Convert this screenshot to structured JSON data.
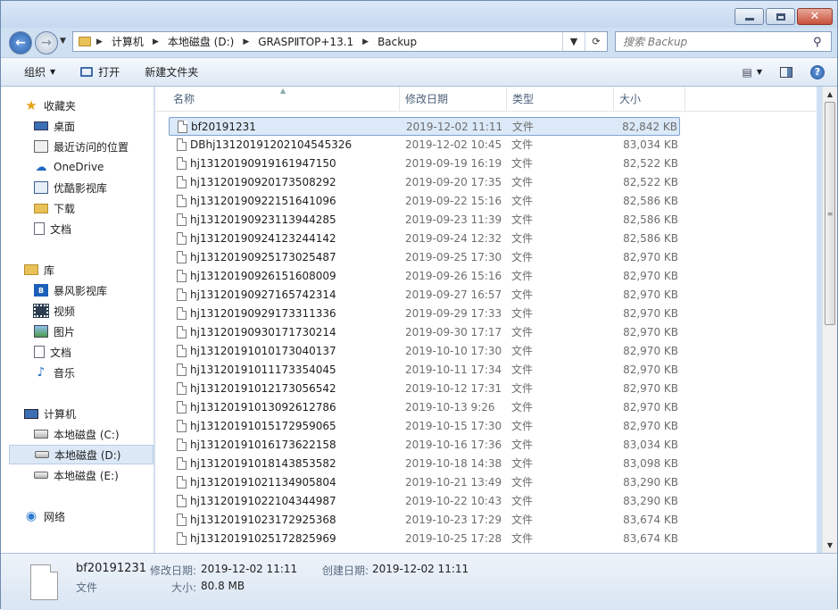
{
  "address": {
    "path": [
      "计算机",
      "本地磁盘 (D:)",
      "GRASPⅡTOP+13.1",
      "Backup"
    ]
  },
  "search": {
    "placeholder": "搜索 Backup"
  },
  "toolbar": {
    "organize": "组织",
    "open": "打开",
    "new_folder": "新建文件夹"
  },
  "nav": {
    "favorites": "收藏夹",
    "fav_items": [
      "桌面",
      "最近访问的位置",
      "OneDrive",
      "优酷影视库",
      "下载",
      "文档"
    ],
    "libraries": "库",
    "lib_items": [
      "暴风影视库",
      "视频",
      "图片",
      "文档",
      "音乐"
    ],
    "computer": "计算机",
    "drives": [
      "本地磁盘 (C:)",
      "本地磁盘 (D:)",
      "本地磁盘 (E:)"
    ],
    "network": "网络"
  },
  "columns": {
    "name": "名称",
    "date": "修改日期",
    "type": "类型",
    "size": "大小"
  },
  "files": [
    {
      "name": "bf20191231",
      "date": "2019-12-02 11:11",
      "type": "文件",
      "size": "82,842 KB"
    },
    {
      "name": "DBhj1312019120210454532​6",
      "date": "2019-12-02 10:45",
      "type": "文件",
      "size": "83,034 KB"
    },
    {
      "name": "hj13120190919161947150",
      "date": "2019-09-19 16:19",
      "type": "文件",
      "size": "82,522 KB"
    },
    {
      "name": "hj13120190920173508292",
      "date": "2019-09-20 17:35",
      "type": "文件",
      "size": "82,522 KB"
    },
    {
      "name": "hj13120190922151641096",
      "date": "2019-09-22 15:16",
      "type": "文件",
      "size": "82,586 KB"
    },
    {
      "name": "hj13120190923113944285",
      "date": "2019-09-23 11:39",
      "type": "文件",
      "size": "82,586 KB"
    },
    {
      "name": "hj13120190924123244142",
      "date": "2019-09-24 12:32",
      "type": "文件",
      "size": "82,586 KB"
    },
    {
      "name": "hj13120190925173025487",
      "date": "2019-09-25 17:30",
      "type": "文件",
      "size": "82,970 KB"
    },
    {
      "name": "hj13120190926151608009",
      "date": "2019-09-26 15:16",
      "type": "文件",
      "size": "82,970 KB"
    },
    {
      "name": "hj13120190927165742314",
      "date": "2019-09-27 16:57",
      "type": "文件",
      "size": "82,970 KB"
    },
    {
      "name": "hj13120190929173311336",
      "date": "2019-09-29 17:33",
      "type": "文件",
      "size": "82,970 KB"
    },
    {
      "name": "hj13120190930171730214",
      "date": "2019-09-30 17:17",
      "type": "文件",
      "size": "82,970 KB"
    },
    {
      "name": "hj13120191010173040137",
      "date": "2019-10-10 17:30",
      "type": "文件",
      "size": "82,970 KB"
    },
    {
      "name": "hj13120191011173354045",
      "date": "2019-10-11 17:34",
      "type": "文件",
      "size": "82,970 KB"
    },
    {
      "name": "hj13120191012173056542",
      "date": "2019-10-12 17:31",
      "type": "文件",
      "size": "82,970 KB"
    },
    {
      "name": "hj13120191013092612786",
      "date": "2019-10-13 9:26",
      "type": "文件",
      "size": "82,970 KB"
    },
    {
      "name": "hj13120191015172959065",
      "date": "2019-10-15 17:30",
      "type": "文件",
      "size": "82,970 KB"
    },
    {
      "name": "hj13120191016173622158",
      "date": "2019-10-16 17:36",
      "type": "文件",
      "size": "83,034 KB"
    },
    {
      "name": "hj13120191018143853582",
      "date": "2019-10-18 14:38",
      "type": "文件",
      "size": "83,098 KB"
    },
    {
      "name": "hj13120191021134905804",
      "date": "2019-10-21 13:49",
      "type": "文件",
      "size": "83,290 KB"
    },
    {
      "name": "hj13120191022104344987",
      "date": "2019-10-22 10:43",
      "type": "文件",
      "size": "83,290 KB"
    },
    {
      "name": "hj13120191023172925368",
      "date": "2019-10-23 17:29",
      "type": "文件",
      "size": "83,674 KB"
    },
    {
      "name": "hj13120191025172825969",
      "date": "2019-10-25 17:28",
      "type": "文件",
      "size": "83,674 KB"
    }
  ],
  "details": {
    "name": "bf20191231",
    "type": "文件",
    "modified_label": "修改日期:",
    "modified": "2019-12-02 11:11",
    "created_label": "创建日期:",
    "created": "2019-12-02 11:11",
    "size_label": "大小:",
    "size": "80.8 MB"
  }
}
